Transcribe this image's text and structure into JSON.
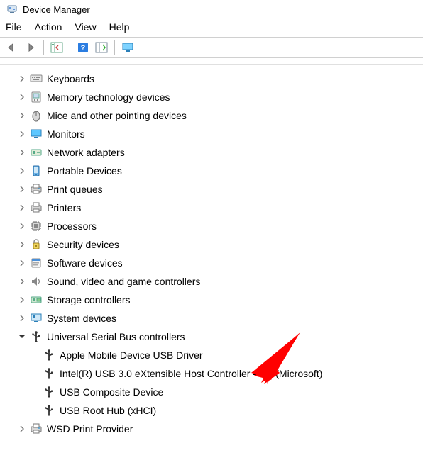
{
  "window": {
    "title": "Device Manager"
  },
  "menu": {
    "items": [
      "File",
      "Action",
      "View",
      "Help"
    ]
  },
  "tree": [
    {
      "icon": "keyboard",
      "label": "Keyboards",
      "expanded": false
    },
    {
      "icon": "memtech",
      "label": "Memory technology devices",
      "expanded": false
    },
    {
      "icon": "mouse",
      "label": "Mice and other pointing devices",
      "expanded": false
    },
    {
      "icon": "monitor",
      "label": "Monitors",
      "expanded": false
    },
    {
      "icon": "netadapter",
      "label": "Network adapters",
      "expanded": false
    },
    {
      "icon": "portable",
      "label": "Portable Devices",
      "expanded": false
    },
    {
      "icon": "printqueue",
      "label": "Print queues",
      "expanded": false
    },
    {
      "icon": "printer",
      "label": "Printers",
      "expanded": false
    },
    {
      "icon": "cpu",
      "label": "Processors",
      "expanded": false
    },
    {
      "icon": "security",
      "label": "Security devices",
      "expanded": false
    },
    {
      "icon": "software",
      "label": "Software devices",
      "expanded": false
    },
    {
      "icon": "sound",
      "label": "Sound, video and game controllers",
      "expanded": false
    },
    {
      "icon": "storage",
      "label": "Storage controllers",
      "expanded": false
    },
    {
      "icon": "system",
      "label": "System devices",
      "expanded": false
    },
    {
      "icon": "usb",
      "label": "Universal Serial Bus controllers",
      "expanded": true,
      "children": [
        {
          "icon": "usb",
          "label": "Apple Mobile Device USB Driver"
        },
        {
          "icon": "usb",
          "label": "Intel(R) USB 3.0 eXtensible Host Controller - 1.0 (Microsoft)"
        },
        {
          "icon": "usb",
          "label": "USB Composite Device"
        },
        {
          "icon": "usb",
          "label": "USB Root Hub (xHCI)"
        }
      ]
    },
    {
      "icon": "printqueue",
      "label": "WSD Print Provider",
      "expanded": false
    }
  ]
}
